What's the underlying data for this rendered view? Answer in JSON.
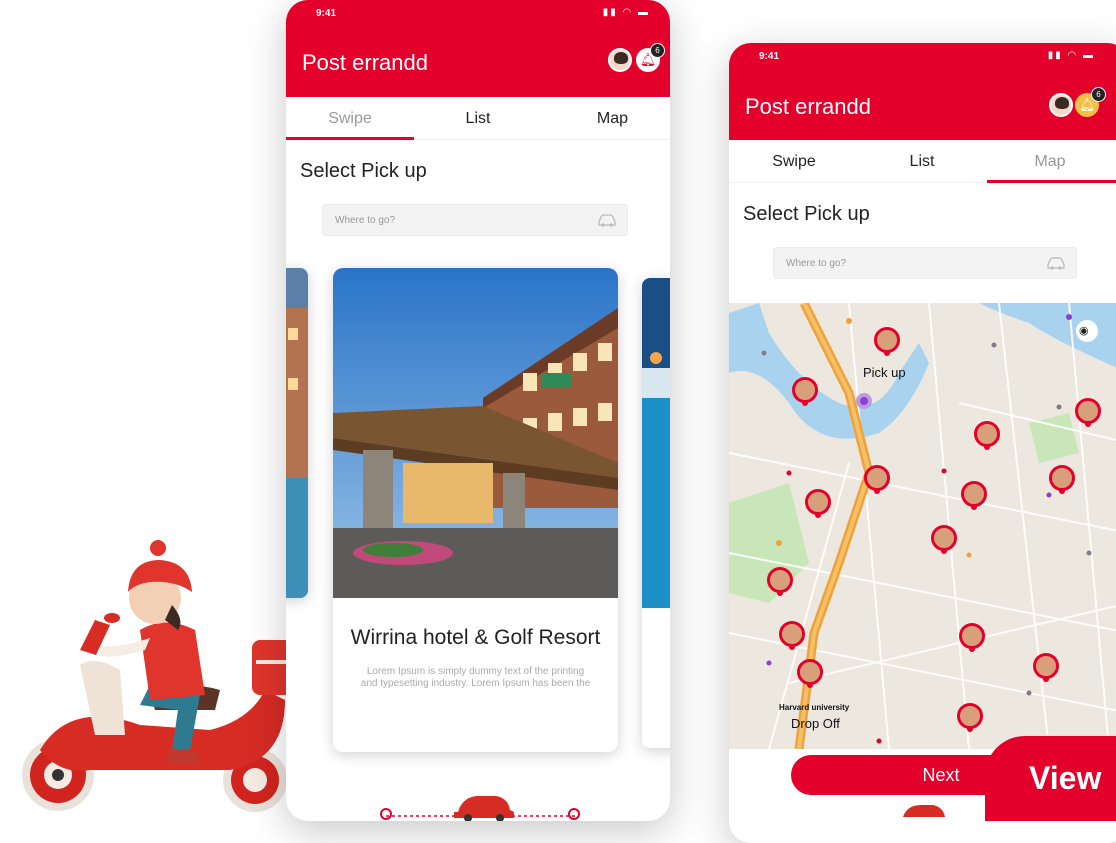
{
  "status_time": "9:41",
  "phone_left": {
    "title": "Post errandd",
    "notification_count": "6",
    "tabs": [
      {
        "label": "Swipe",
        "active": true
      },
      {
        "label": "List",
        "active": false
      },
      {
        "label": "Map",
        "active": false
      }
    ],
    "section_label": "Select Pick up",
    "search": {
      "placeholder": "Where to go?"
    },
    "card": {
      "title": "Wirrina hotel & Golf Resort",
      "description": "Lorem Ipsum is simply dummy text of the printing and typesetting industry. Lorem Ipsum has been the"
    }
  },
  "phone_right": {
    "title": "Post errandd",
    "notification_count": "6",
    "tabs": [
      {
        "label": "Swipe",
        "active": false
      },
      {
        "label": "List",
        "active": false
      },
      {
        "label": "Map",
        "active": true
      }
    ],
    "section_label": "Select Pick up",
    "search": {
      "placeholder": "Where to go?"
    },
    "map": {
      "pickup_label": "Pick up",
      "dropoff_label": "Drop Off",
      "dropoff_place": "Harvard university"
    },
    "next_label": "Next"
  },
  "view_label": "View",
  "colors": {
    "brand": "#e3002b",
    "map_bg": "#ece7df",
    "road": "#f0a23a",
    "river": "#a9d2ef",
    "park": "#c9e6b9"
  }
}
